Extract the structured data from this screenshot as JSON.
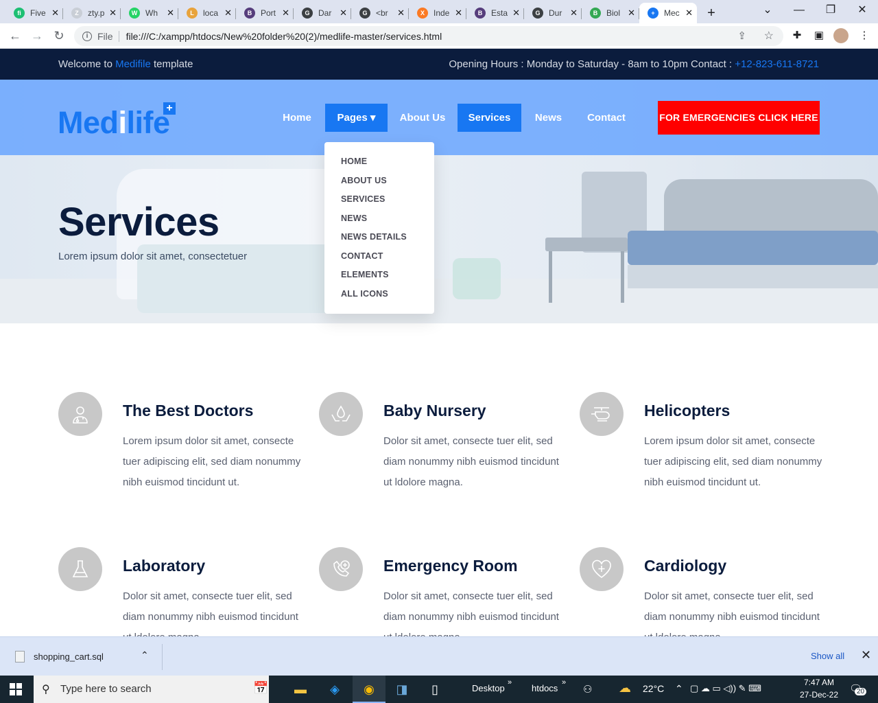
{
  "browser": {
    "tabs": [
      {
        "title": "Five",
        "color": "#1dbf73",
        "glyph": "fi"
      },
      {
        "title": "zty.p",
        "color": "#c9ced6",
        "glyph": "Z"
      },
      {
        "title": "Wh",
        "color": "#25d366",
        "glyph": "W"
      },
      {
        "title": "loca",
        "color": "#e8a33c",
        "glyph": "L"
      },
      {
        "title": "Port",
        "color": "#563d7c",
        "glyph": "B"
      },
      {
        "title": "Dar",
        "color": "#3c4043",
        "glyph": "G"
      },
      {
        "title": "<br",
        "color": "#3c4043",
        "glyph": "G"
      },
      {
        "title": "Inde",
        "color": "#fb7a24",
        "glyph": "X"
      },
      {
        "title": "Esta",
        "color": "#563d7c",
        "glyph": "B"
      },
      {
        "title": "Dur",
        "color": "#3c4043",
        "glyph": "G"
      },
      {
        "title": "Biol",
        "color": "#34a853",
        "glyph": "B"
      },
      {
        "title": "Mec",
        "color": "#1877f2",
        "glyph": "+"
      }
    ],
    "new_tab": "+",
    "scheme_label": "File",
    "url": "file:///C:/xampp/htdocs/New%20folder%20(2)/medlife-master/services.html"
  },
  "site": {
    "topbar": {
      "welcome_pre": "Welcome to ",
      "welcome_brand": "Medifile",
      "welcome_post": " template",
      "hours": "Opening Hours : Monday to Saturday - 8am to 10pm Contact : ",
      "phone": "+12-823-611-8721"
    },
    "logo": {
      "part1": "Med",
      "part2": "i",
      "part3": "life",
      "plus": "+"
    },
    "nav": {
      "home": "Home",
      "pages": "Pages ▾",
      "about": "About Us",
      "services": "Services",
      "news": "News",
      "contact": "Contact"
    },
    "emergency": "FOR EMERGENCIES CLICK HERE",
    "dropdown": [
      "HOME",
      "ABOUT US",
      "SERVICES",
      "NEWS",
      "NEWS DETAILS",
      "CONTACT",
      "ELEMENTS",
      "ALL ICONS"
    ],
    "hero": {
      "title": "Services",
      "subtitle": "Lorem ipsum dolor sit amet, consectetuer"
    },
    "services": [
      {
        "title": "The Best Doctors",
        "icon": "doctor-icon",
        "text": "Lorem ipsum dolor sit amet, consecte tuer adipiscing elit, sed diam nonummy nibh euismod tincidunt ut."
      },
      {
        "title": "Baby Nursery",
        "icon": "nursery-icon",
        "text": "Dolor sit amet, consecte tuer elit, sed diam nonummy nibh euismod tincidunt ut ldolore magna."
      },
      {
        "title": "Helicopters",
        "icon": "helicopter-icon",
        "text": "Lorem ipsum dolor sit amet, consecte tuer adipiscing elit, sed diam nonummy nibh euismod tincidunt ut."
      },
      {
        "title": "Laboratory",
        "icon": "flask-icon",
        "text": "Dolor sit amet, consecte tuer elit, sed diam nonummy nibh euismod tincidunt ut ldolore magna."
      },
      {
        "title": "Emergency Room",
        "icon": "emergency-icon",
        "text": "Dolor sit amet, consecte tuer elit, sed diam nonummy nibh euismod tincidunt ut ldolore magna."
      },
      {
        "title": "Cardiology",
        "icon": "heart-icon",
        "text": "Dolor sit amet, consecte tuer elit, sed diam nonummy nibh euismod tincidunt ut ldolore magna."
      }
    ],
    "colors": {
      "brand": "#1877f2",
      "dark": "#0b1c3d",
      "emergency": "#ff0000"
    }
  },
  "downloads": {
    "file": "shopping_cart.sql",
    "show_all": "Show all"
  },
  "taskbar": {
    "search_placeholder": "Type here to search",
    "desktop": "Desktop",
    "htdocs": "htdocs",
    "weather": "22°C",
    "time": "7:47 AM",
    "date": "27-Dec-22",
    "notifications": "20"
  }
}
